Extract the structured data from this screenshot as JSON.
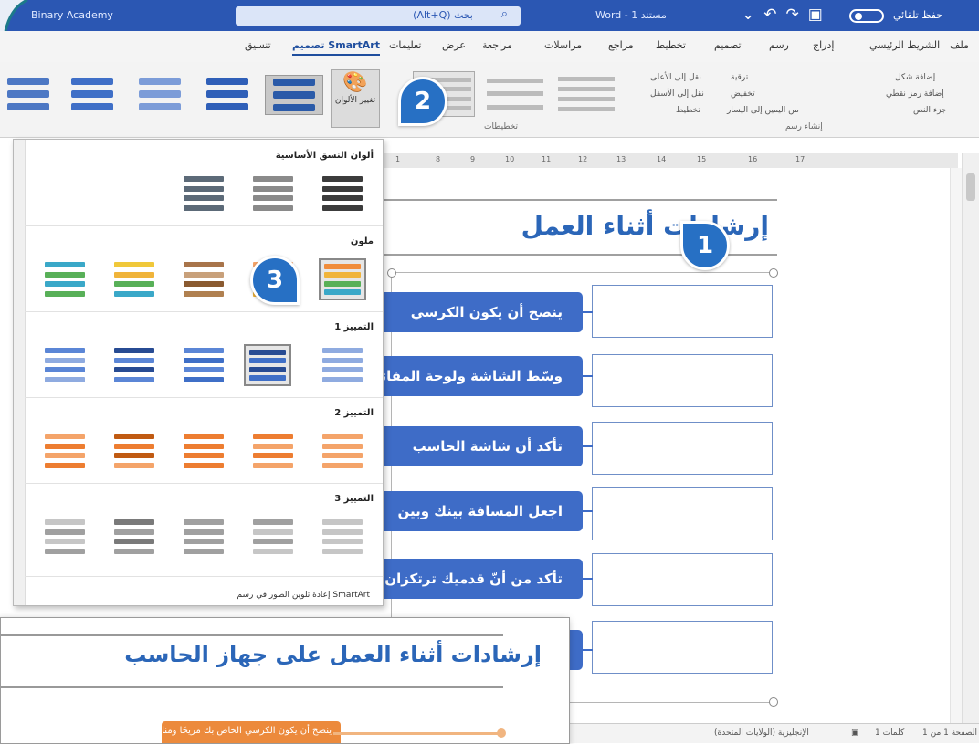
{
  "titlebar": {
    "account": "Binary Academy",
    "search_placeholder": "(Alt+Q) بحث",
    "doc_name": "Word - 1 مستند",
    "autosave": "حفظ تلقائي"
  },
  "tabs": [
    "ملف",
    "الشريط الرئيسي",
    "إدراج",
    "رسم",
    "تصميم",
    "تخطيط",
    "مراجع",
    "مراسلات",
    "مراجعة",
    "عرض",
    "تعليمات",
    "تصميم SmartArt",
    "تنسيق"
  ],
  "active_tab": "تصميم SmartArt",
  "ribbon": {
    "change_colors": "تغيير الألوان",
    "group_layouts": "تخطيطات",
    "group_create": "إنشاء رسم",
    "add_shape": "إضافة شكل",
    "add_bullet": "إضافة رمز نقطي",
    "text_pane": "جزء النص",
    "promote": "ترقية",
    "demote": "تخفيض",
    "rtl": "من اليمين إلى اليسار",
    "move_up": "نقل إلى الأعلى",
    "move_down": "نقل إلى الأسفل",
    "layout": "تخطيط"
  },
  "gallery": {
    "primary_header": "ألوان النسق الأساسية",
    "colorful_header": "ملون",
    "accent1_header": "التمييز 1",
    "accent2_header": "التمييز 2",
    "accent3_header": "التمييز 3",
    "recolor": "إعادة تلوين الصور في رسم SmartArt",
    "colors": {
      "primary": [
        "#3c3c3c",
        "#8a8a8a",
        "#5c6a78"
      ],
      "colorful": [
        "#f08c3a",
        "#f0b43a",
        "#a8744a",
        "#58b058",
        "#3aa8c8"
      ],
      "accent1": [
        "#3f6fc7",
        "#5b86d6",
        "#274b93",
        "#8fabe0"
      ],
      "accent2": [
        "#ed7d31",
        "#f4a46a",
        "#c05a12"
      ],
      "accent3": [
        "#a0a0a0",
        "#7a7a7a",
        "#c6c6c6"
      ]
    }
  },
  "ruler_marks": [
    "1",
    "8",
    "9",
    "10",
    "11",
    "12",
    "13",
    "14",
    "15",
    "16",
    "17"
  ],
  "document": {
    "heading": "إرشادات أثناء العمل",
    "items": [
      "ينصح أن يكون الكرسي",
      "وسّط الشاشة ولوحة المفاتيح",
      "تأكد أن شاشة الحاسب",
      "اجعل المسافة بينك وبين",
      "تأكد من أنّ قدميك ترتكزان"
    ]
  },
  "inset": {
    "heading": "إرشادات أثناء العمل على جهاز الحاسب",
    "item": "ينصح أن يكون الكرسي الخاص بك مريحًا ومناسبًا"
  },
  "statusbar": {
    "page": "الصفحة 1 من 1",
    "words": "1 كلمات",
    "language": "الإنجليزية (الولايات المتحدة)"
  },
  "callouts": [
    "1",
    "2",
    "3"
  ]
}
